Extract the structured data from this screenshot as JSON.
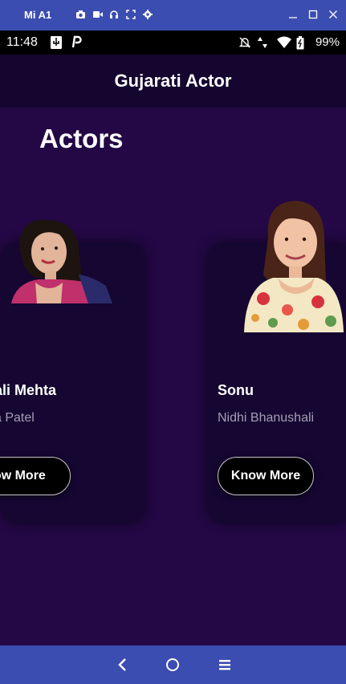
{
  "window": {
    "title": "Mi A1",
    "tool_icons": [
      "camera-icon",
      "video-icon",
      "headphones-icon",
      "fullscreen-icon",
      "settings-icon"
    ],
    "control_icons": [
      "minimize-icon",
      "maximize-icon",
      "close-icon"
    ]
  },
  "status_bar": {
    "time": "11:48",
    "left_icons": [
      "usb-icon",
      "p-icon"
    ],
    "right_icons": [
      "mute-icon",
      "data-icon",
      "wifi-icon",
      "battery-icon"
    ],
    "battery": "99%"
  },
  "app_bar": {
    "title": "Gujarati Actor"
  },
  "main": {
    "section_title": "Actors",
    "cards": [
      {
        "name": "ali Mehta",
        "role": "a Patel",
        "button": "now More"
      },
      {
        "name": "Sonu",
        "role": "Nidhi Bhanushali",
        "button": "Know More"
      }
    ]
  },
  "nav_bar": {
    "icons": [
      "back-icon",
      "home-icon",
      "recents-icon"
    ]
  },
  "colors": {
    "window_bar": "#3b4db0",
    "app_bar": "#14062f",
    "content_bg": "#230845",
    "card_bg": "#150632",
    "role_text": "#a59fb5"
  }
}
